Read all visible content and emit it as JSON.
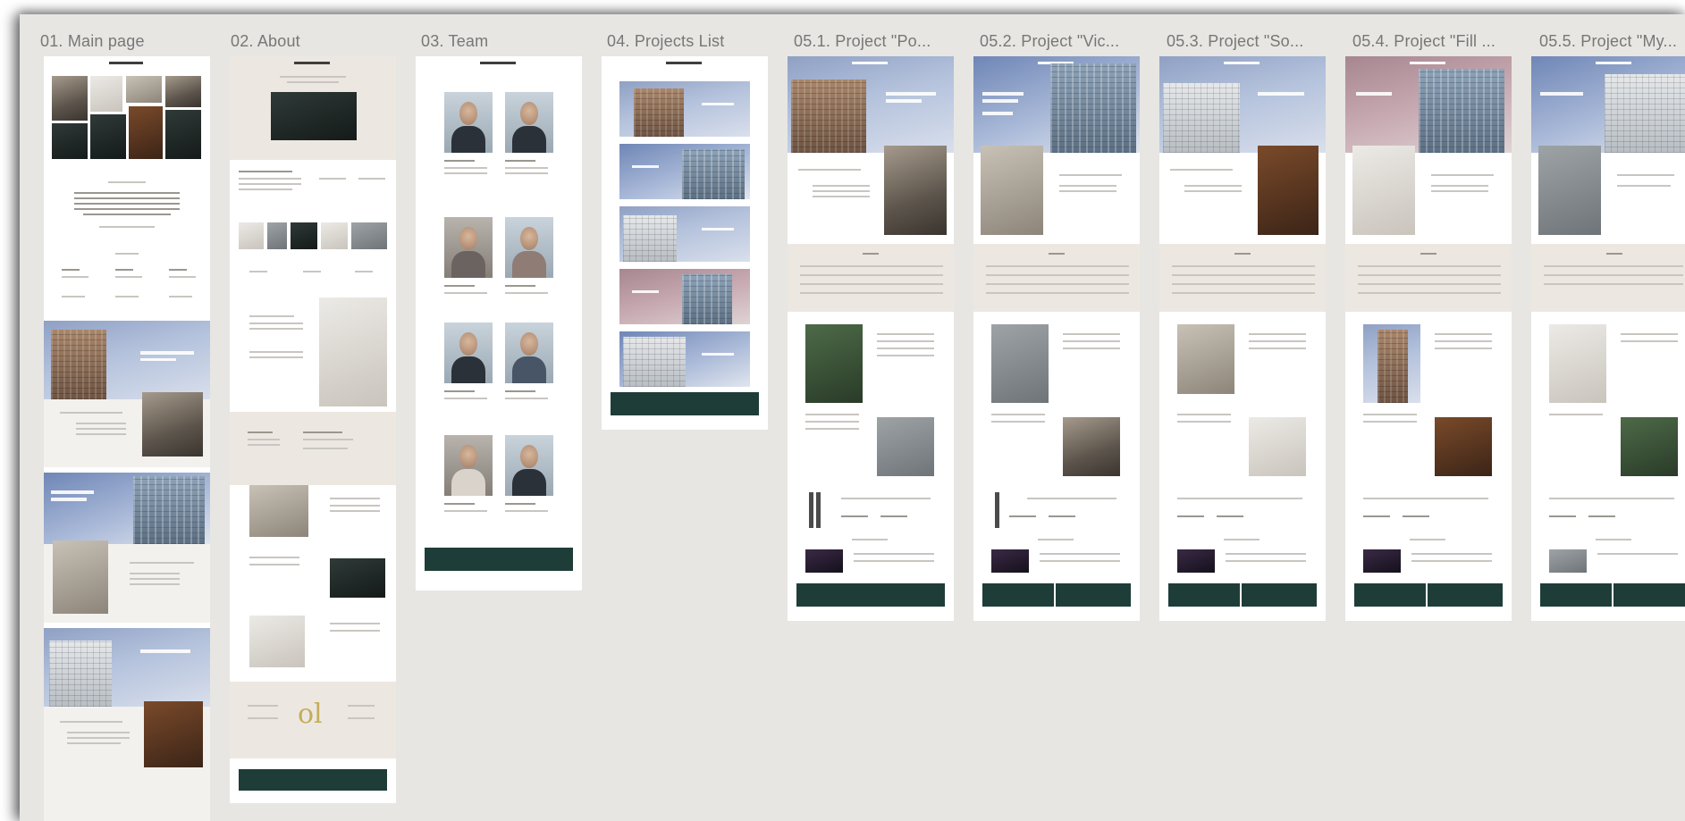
{
  "frames": [
    {
      "id": "main",
      "title": "01. Main page"
    },
    {
      "id": "about",
      "title": "02. About"
    },
    {
      "id": "team",
      "title": "03. Team"
    },
    {
      "id": "projects",
      "title": "04. Projects List"
    },
    {
      "id": "p1",
      "title": "05.1. Project \"Po..."
    },
    {
      "id": "p2",
      "title": "05.2. Project \"Vic..."
    },
    {
      "id": "p3",
      "title": "05.3. Project \"So..."
    },
    {
      "id": "p4",
      "title": "05.4. Project \"Fill ..."
    },
    {
      "id": "p5",
      "title": "05.5. Project \"My..."
    }
  ],
  "colors": {
    "canvas": "#e7e6e3",
    "board": "#ffffff",
    "beige_section": "#ece8e1",
    "accent_button": "#1f3d38",
    "title_text": "#777777",
    "logo_gold": "#c4ad5a"
  },
  "icons": {
    "logo": "oi-monogram"
  }
}
